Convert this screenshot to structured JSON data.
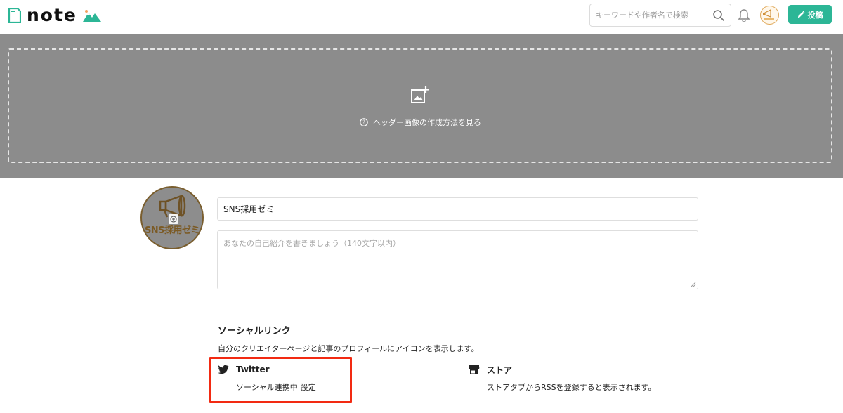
{
  "header": {
    "logo_text": "note",
    "search_placeholder": "キーワードや作者名で検索",
    "post_button_label": "投稿"
  },
  "cover": {
    "help_text": "ヘッダー画像の作成方法を見る"
  },
  "profile": {
    "avatar_text": "SNS採用ゼミ",
    "name_value": "SNS採用ゼミ",
    "bio_placeholder": "あなたの自己紹介を書きましょう（140文字以内）"
  },
  "social": {
    "title": "ソーシャルリンク",
    "description": "自分のクリエイターページと記事のプロフィールにアイコンを表示します。",
    "twitter": {
      "name": "Twitter",
      "status": "ソーシャル連携中",
      "settings_link": "設定"
    },
    "store": {
      "name": "ストア",
      "description": "ストアタブからRSSを登録すると表示されます。"
    }
  },
  "colors": {
    "brand_green": "#2cb696",
    "cover_gray": "#8c8c8c",
    "highlight_red": "#f22a12"
  }
}
